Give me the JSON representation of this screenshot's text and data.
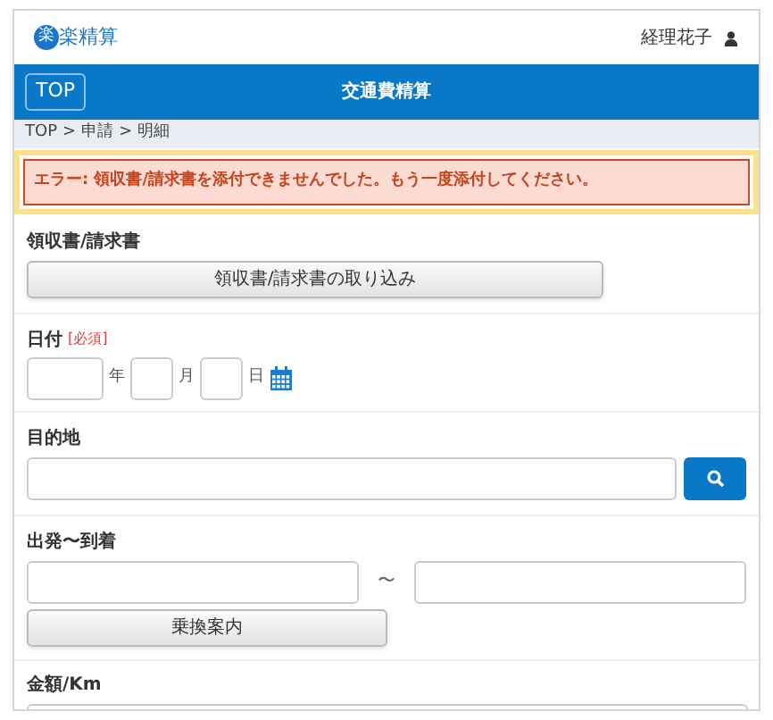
{
  "header": {
    "logo_mark": "楽",
    "logo_text": "楽精算",
    "user": "経理花子"
  },
  "nav": {
    "top_button": "TOP",
    "title": "交通費精算"
  },
  "breadcrumb": [
    "TOP",
    ">",
    "申請",
    ">",
    "明細"
  ],
  "error": "エラー: 領収書/請求書を添付できませんでした。もう一度添付してください。",
  "receipt": {
    "label": "領収書/請求書",
    "button": "領収書/請求書の取り込み"
  },
  "date": {
    "label": "日付",
    "required": "[必須]",
    "units": [
      "年",
      "月",
      "日"
    ]
  },
  "destination": {
    "label": "目的地"
  },
  "route": {
    "label": "出発〜到着",
    "separator": "〜",
    "button": "乗換案内"
  },
  "amount": {
    "label": "金額/Km"
  }
}
